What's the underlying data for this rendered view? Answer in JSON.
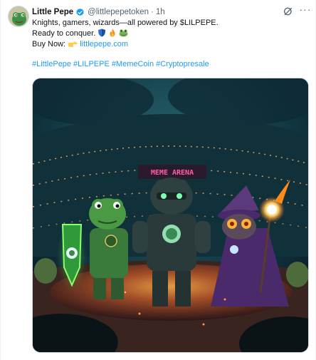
{
  "tweet": {
    "author_name": "Little Pepe",
    "author_handle": "@littlepepetoken",
    "separator": "·",
    "timestamp": "1h",
    "more_label": "···",
    "line1": "Knights, gamers, wizards—all powered by $LILPEPE.",
    "line2_text": "Ready to conquer.",
    "line3_prefix": "Buy Now:",
    "link_text": "littlepepe.com",
    "hashtags": [
      "#LittlePepe",
      "#LILPEPE",
      "#MemeCoin",
      "#Cryptopresale"
    ]
  },
  "media": {
    "arena_sign": "MEME ARENA"
  },
  "icons": {
    "verified": "verified-badge-icon",
    "grok": "grok-icon",
    "more": "more-options-icon",
    "shield_emoji": "shield-emoji",
    "fire_emoji": "fire-emoji",
    "frog_emoji": "frog-emoji",
    "pointing_emoji": "pointing-right-emoji"
  },
  "colors": {
    "link": "#1d9bf0",
    "text": "#0f1419",
    "secondary": "#536471",
    "verified": "#1d9bf0",
    "sign_glow": "#ff5fa2"
  }
}
